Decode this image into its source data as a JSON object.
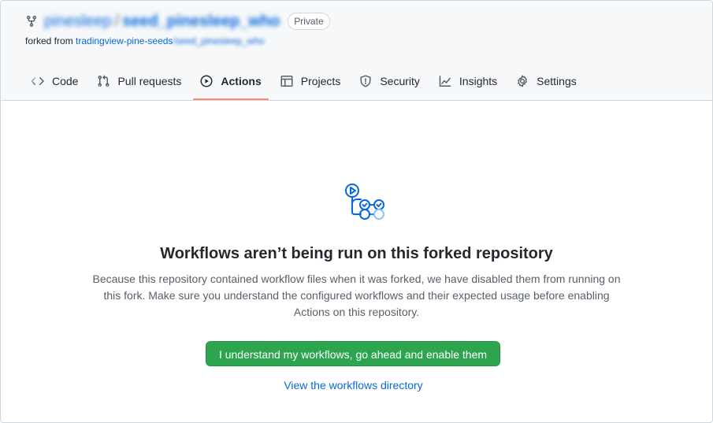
{
  "repo": {
    "owner": "pinesleep",
    "separator": "/",
    "name": "seed_pinesleep_who",
    "visibility_badge": "Private",
    "forked_from_prefix": "forked from ",
    "forked_from_org": "tradingview-pine-seeds",
    "forked_from_sep": "/",
    "forked_from_repo": "seed_pinesleep_who"
  },
  "nav": {
    "tabs": [
      {
        "label": "Code",
        "icon": "code-icon"
      },
      {
        "label": "Pull requests",
        "icon": "pull-request-icon"
      },
      {
        "label": "Actions",
        "icon": "play-icon",
        "active": true
      },
      {
        "label": "Projects",
        "icon": "table-icon"
      },
      {
        "label": "Security",
        "icon": "shield-icon"
      },
      {
        "label": "Insights",
        "icon": "graph-icon"
      },
      {
        "label": "Settings",
        "icon": "gear-icon"
      }
    ]
  },
  "blankslate": {
    "icon": "workflow-illustration-icon",
    "title": "Workflows aren’t being run on this forked repository",
    "description": "Because this repository contained workflow files when it was forked, we have disabled them from running on this fork. Make sure you understand the configured workflows and their expected usage before enabling Actions on this repository.",
    "primary_button": "I understand my workflows, go ahead and enable them",
    "secondary_link": "View the workflows directory"
  },
  "colors": {
    "accent_blue": "#0969da",
    "primary_green": "#2da44e",
    "active_tab_underline": "#fd8c73",
    "header_bg": "#f6f8fa"
  }
}
